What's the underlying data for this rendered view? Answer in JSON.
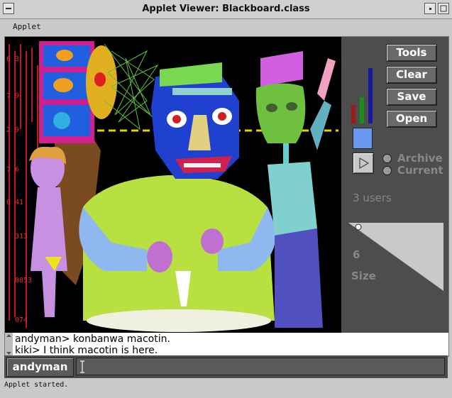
{
  "window": {
    "title": "Applet Viewer: Blackboard.class"
  },
  "menubar": {
    "items": [
      "Applet"
    ]
  },
  "toolbar": {
    "tools_label": "Tools",
    "clear_label": "Clear",
    "save_label": "Save",
    "open_label": "Open"
  },
  "mode": {
    "archive_label": "Archive",
    "current_label": "Current"
  },
  "users_count": "3 users",
  "size": {
    "value": "6",
    "label": "Size"
  },
  "chat": {
    "lines": [
      "andyman> konbanwa macotin.",
      "kiki> I think macotin is here."
    ]
  },
  "input": {
    "username": "andyman",
    "value": ""
  },
  "status": {
    "text": "Applet started."
  },
  "colors": {
    "current_color": "#6a98f0",
    "level_red": 0.24,
    "level_green": 0.34,
    "level_blue": 0.72
  },
  "canvas": {
    "margin_numbers": [
      "6 3",
      "7 9",
      "2 9",
      "7 6",
      "0 41",
      "313",
      "0853",
      "074"
    ]
  }
}
